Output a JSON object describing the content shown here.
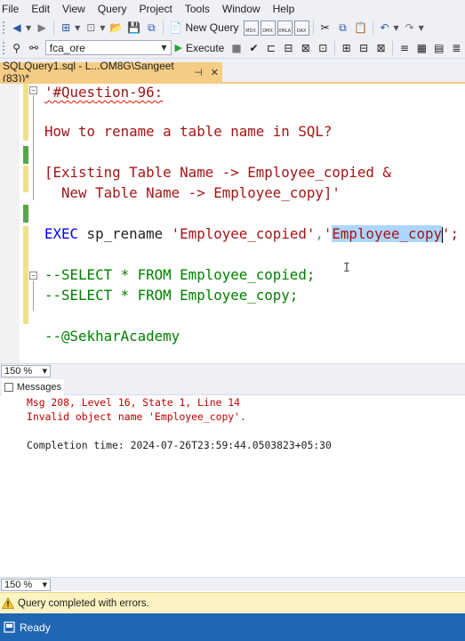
{
  "menu": [
    "File",
    "Edit",
    "View",
    "Query",
    "Project",
    "Tools",
    "Window",
    "Help"
  ],
  "toolbar": {
    "new_query_label": "New Query",
    "tiny_icons": [
      "MDX",
      "DMX",
      "XMLA",
      "DAX"
    ]
  },
  "toolbar2": {
    "database": "fca_ore",
    "execute_label": "Execute"
  },
  "tab": {
    "title": "SQLQuery1.sql - L...OM8G\\Sangeet (83))*",
    "pin": "⊣",
    "close": "✕"
  },
  "editor": {
    "line1": "'#Question-96:",
    "line2": "How to rename a table name in SQL?",
    "line3": "[Existing Table Name -> Employee_copied &",
    "line4": "  New Table Name -> Employee_copy]'",
    "exec_kw": "EXEC",
    "exec_proc": " sp_rename ",
    "exec_arg1": "'Employee_copied'",
    "exec_comma": ",",
    "exec_quote": "'",
    "exec_sel": "Employee_copy",
    "exec_end": "';",
    "line6": "--SELECT * FROM Employee_copied;",
    "line7": "--SELECT * FROM Employee_copy;",
    "line8": "--@SekharAcademy"
  },
  "zoom": {
    "editor": "150 %",
    "results": "150 %"
  },
  "messages": {
    "tab_label": "Messages",
    "line1": "Msg 208, Level 16, State 1, Line 14",
    "line2": "Invalid object name 'Employee_copy'.",
    "line3": "Completion time: 2024-07-26T23:59:44.0503823+05:30"
  },
  "status": {
    "query": "Query completed with errors.",
    "ready": "Ready"
  },
  "colors": {
    "tab_accent": "#f5cc84",
    "status_bar": "#1f66b3",
    "error_text": "#c00000",
    "string_red": "#a31515",
    "comment_green": "#008000",
    "keyword_blue": "#0000ff"
  }
}
